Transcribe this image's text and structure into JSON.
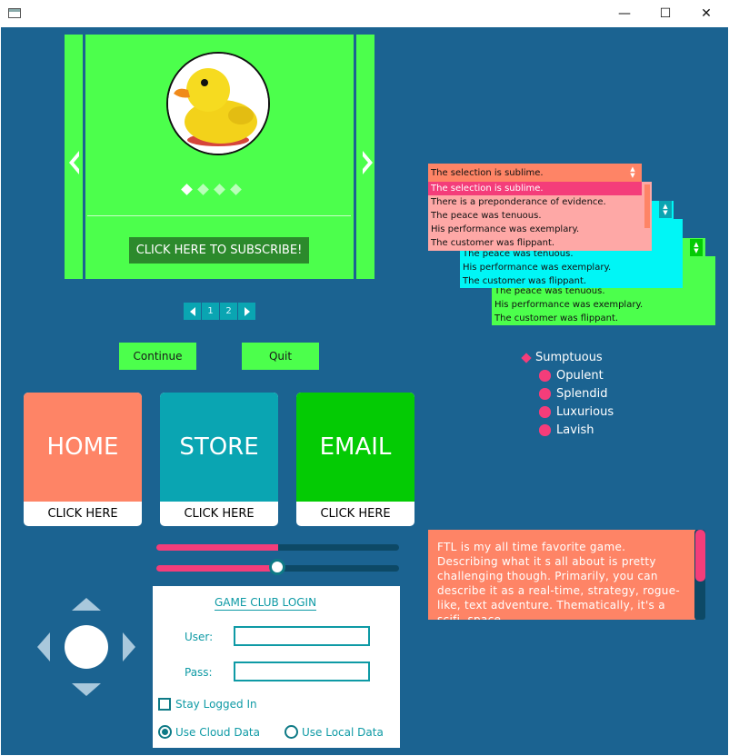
{
  "window": {
    "minimize_glyph": "—",
    "maximize_glyph": "☐",
    "close_glyph": "✕"
  },
  "carousel": {
    "prev_icon": "chevron-left-icon",
    "next_icon": "chevron-right-icon",
    "image": "rubber-duck",
    "dots": 4,
    "active_dot": 1,
    "subscribe_label": "CLICK HERE TO SUBSCRIBE!"
  },
  "pager": {
    "pages": [
      "1",
      "2"
    ]
  },
  "buttons": {
    "continue": "Continue",
    "quit": "Quit"
  },
  "tiles": [
    {
      "title": "HOME",
      "sub": "CLICK HERE",
      "color": "#fe8466"
    },
    {
      "title": "STORE",
      "sub": "CLICK HERE",
      "color": "#0aa5b2"
    },
    {
      "title": "EMAIL",
      "sub": "CLICK HERE",
      "color": "#04cb04"
    }
  ],
  "sliders": [
    {
      "value": 0.5
    },
    {
      "value": 0.5
    }
  ],
  "login": {
    "title": "GAME CLUB LOGIN",
    "user_label": "User:",
    "pass_label": "Pass:",
    "stay_logged_in": "Stay Logged In",
    "cloud": "Use Cloud Data",
    "local": "Use Local Data",
    "selected": "cloud"
  },
  "combos": {
    "red": {
      "selected": "The selection is sublime.",
      "items": [
        "The selection is sublime.",
        "There is a preponderance of evidence.",
        "The peace was tenuous.",
        "His performance was exemplary.",
        "The customer was flippant."
      ]
    },
    "cyan": {
      "items": [
        "The peace was tenuous.",
        "His performance was exemplary.",
        "The customer was flippant."
      ]
    },
    "green": {
      "items": [
        "The peace was tenuous.",
        "His performance was exemplary.",
        "The customer was flippant."
      ]
    }
  },
  "tree": {
    "root": "Sumptuous",
    "children": [
      "Opulent",
      "Splendid",
      "Luxurious",
      "Lavish"
    ]
  },
  "textarea": {
    "text": "FTL is my all time favorite game. Describing what it s all about is pretty challenging though. Primarily, you can describe it as a real-time, strategy, rogue-like, text adventure. Thematically, it's a scifi, space"
  },
  "colors": {
    "background": "#1b6391",
    "accent_green": "#4cff4c",
    "accent_pink": "#f43d7a",
    "accent_teal": "#0e9aa5"
  }
}
